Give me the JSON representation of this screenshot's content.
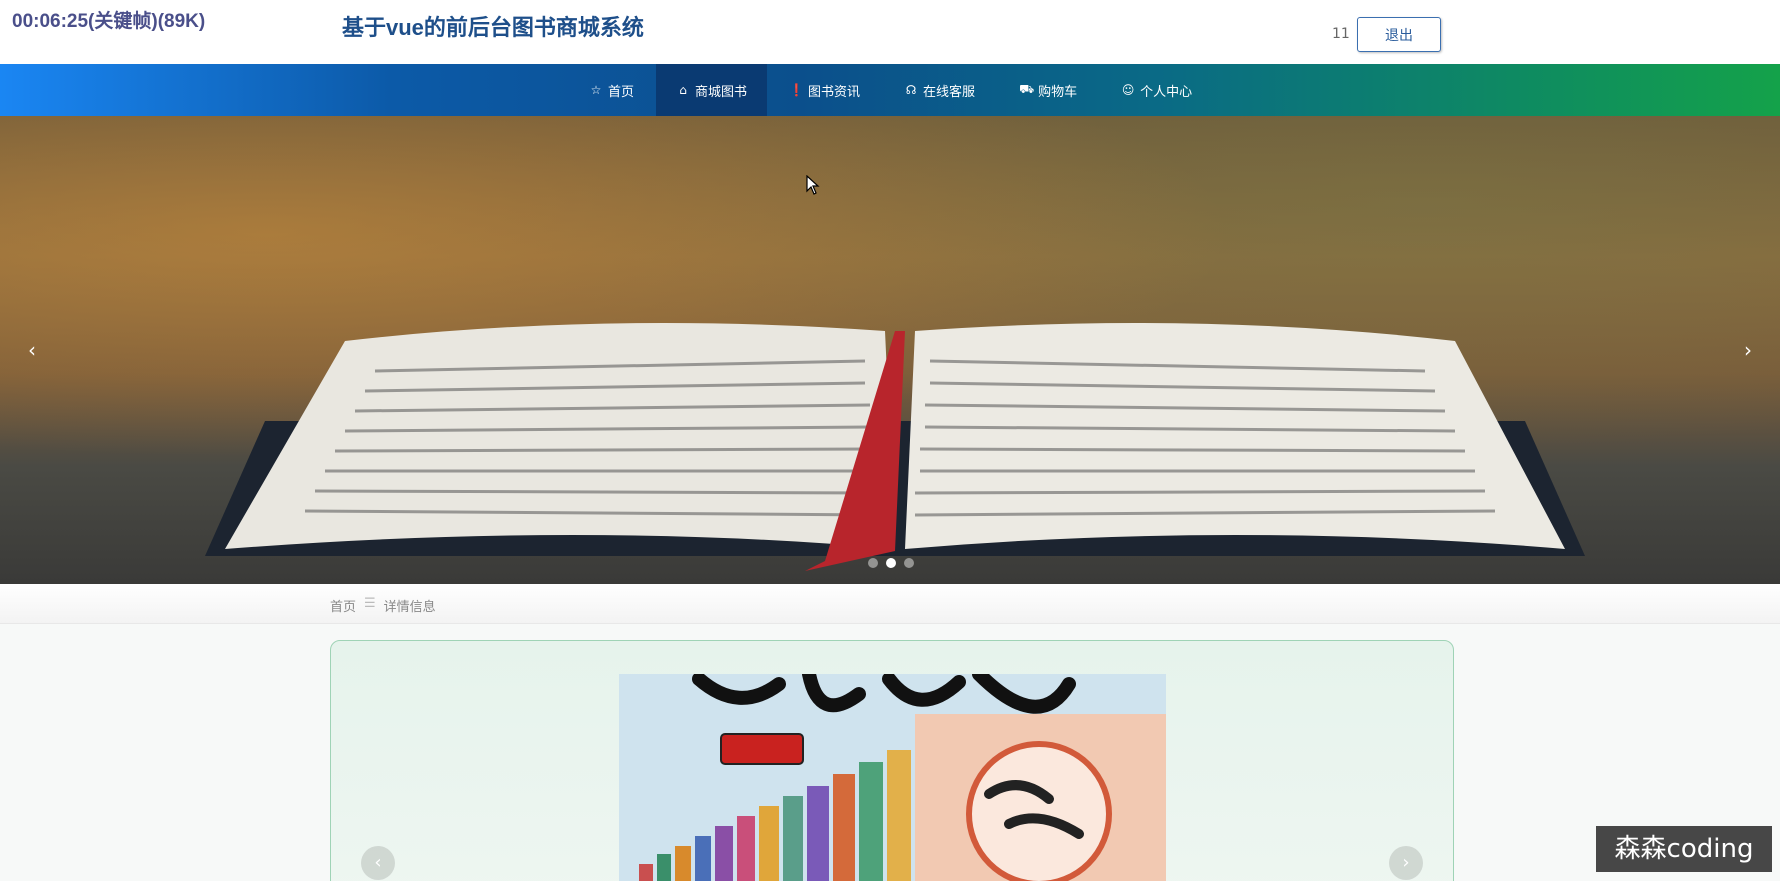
{
  "overlay": {
    "timecode": "00:06:25(关键帧)(89K)"
  },
  "header": {
    "title": "基于vue的前后台图书商城系统",
    "username": "11",
    "logout_label": "退出"
  },
  "nav": {
    "items": [
      {
        "label": "首页",
        "icon": "star-icon",
        "glyph": "☆"
      },
      {
        "label": "商城图书",
        "icon": "shopping-bag-icon",
        "glyph": "⌂",
        "active": true
      },
      {
        "label": "图书资讯",
        "icon": "info-circle-icon",
        "glyph": "❗"
      },
      {
        "label": "在线客服",
        "icon": "headset-icon",
        "glyph": "☊"
      },
      {
        "label": "购物车",
        "icon": "cart-icon",
        "glyph": "⛟"
      },
      {
        "label": "个人中心",
        "icon": "user-icon",
        "glyph": "☺"
      }
    ]
  },
  "banner": {
    "prev_glyph": "‹",
    "next_glyph": "›",
    "slide_count": 3,
    "active_slide": 2
  },
  "breadcrumb": {
    "home": "首页",
    "separator": "☰",
    "current": "详情信息"
  },
  "detail": {
    "gallery_prev_glyph": "‹",
    "gallery_next_glyph": "›"
  },
  "watermark": {
    "text": "森森coding"
  }
}
